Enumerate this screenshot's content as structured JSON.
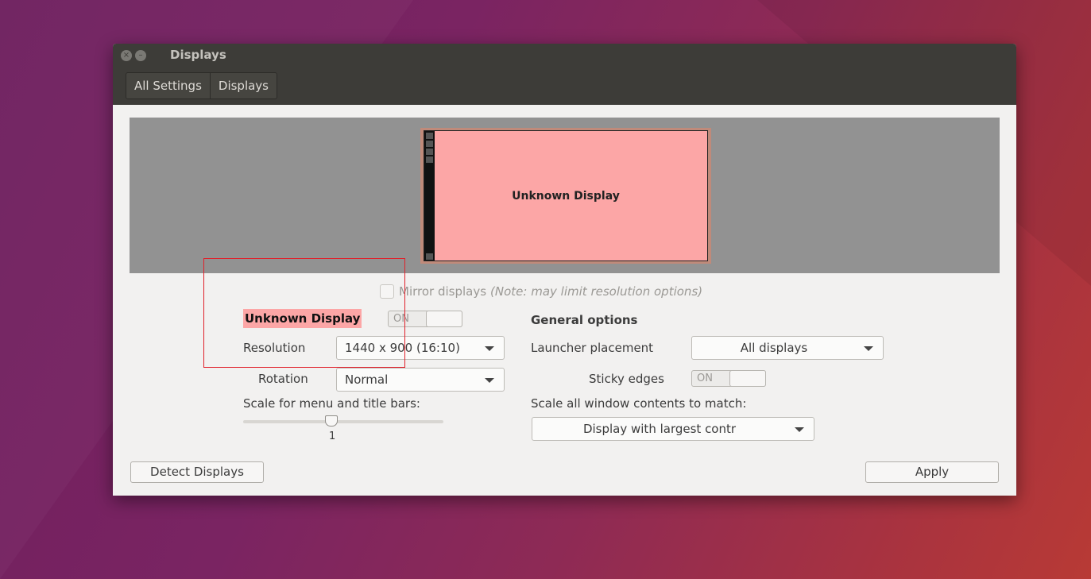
{
  "window": {
    "title": "Displays",
    "close_icon": "close-icon",
    "minimize_icon": "minimize-icon"
  },
  "breadcrumbs": [
    "All Settings",
    "Displays"
  ],
  "preview": {
    "monitor_label": "Unknown Display"
  },
  "mirror": {
    "label": "Mirror displays",
    "note": "(Note: may limit resolution options)",
    "checked": false
  },
  "display": {
    "name": "Unknown Display",
    "toggle_label": "ON",
    "resolution_label": "Resolution",
    "resolution_value": "1440 x 900 (16:10)",
    "rotation_label": "Rotation",
    "rotation_value": "Normal",
    "scale_label": "Scale for menu and title bars:",
    "scale_value": "1"
  },
  "general": {
    "heading": "General options",
    "launcher_label": "Launcher placement",
    "launcher_value": "All displays",
    "sticky_label": "Sticky edges",
    "sticky_toggle": "ON",
    "scale_all_label": "Scale all window contents to match:",
    "scale_all_value": "Display with largest contr"
  },
  "buttons": {
    "detect": "Detect Displays",
    "apply": "Apply"
  },
  "colors": {
    "titlebar": "#3d3c38",
    "display_highlight": "#fca6a6",
    "annotation_box": "#e0202a"
  }
}
